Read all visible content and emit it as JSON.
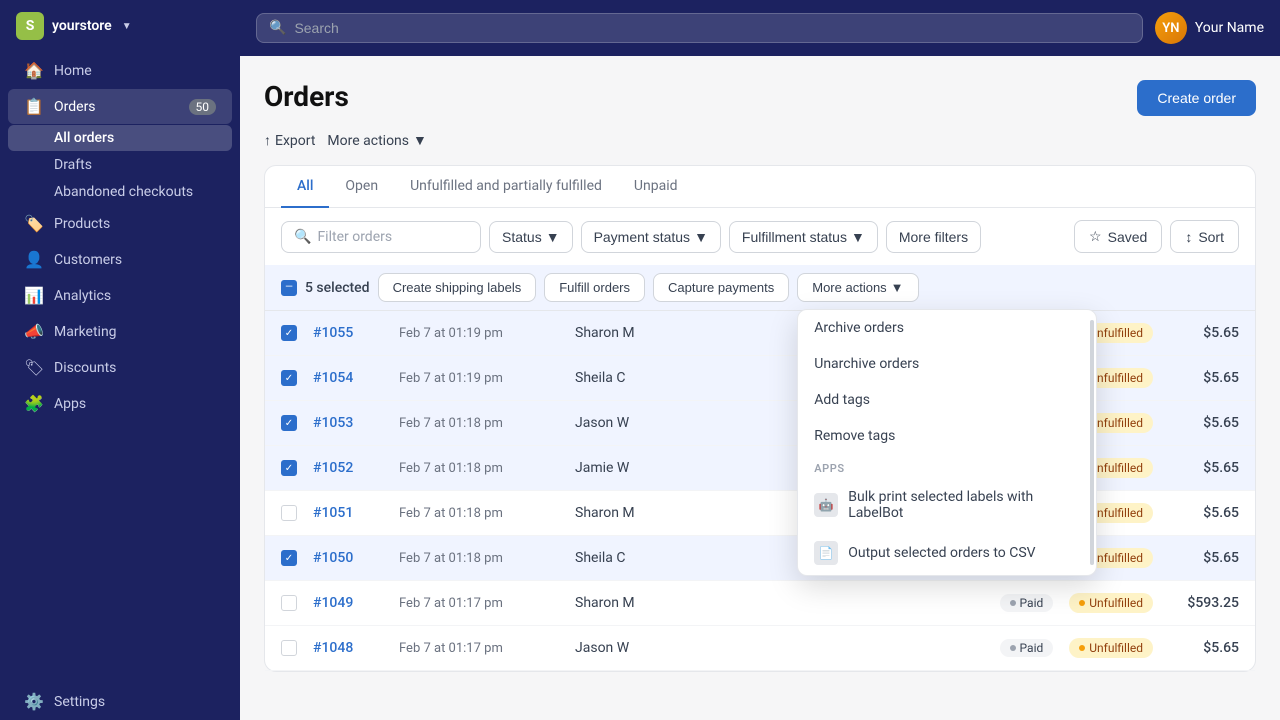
{
  "sidebar": {
    "store": {
      "name": "yourstore",
      "logo": "S"
    },
    "nav_items": [
      {
        "id": "home",
        "label": "Home",
        "icon": "🏠",
        "badge": null
      },
      {
        "id": "orders",
        "label": "Orders",
        "icon": "📋",
        "badge": "50"
      },
      {
        "id": "products",
        "label": "Products",
        "icon": "🏷️",
        "badge": null
      },
      {
        "id": "customers",
        "label": "Customers",
        "icon": "👤",
        "badge": null
      },
      {
        "id": "analytics",
        "label": "Analytics",
        "icon": "📊",
        "badge": null
      },
      {
        "id": "marketing",
        "label": "Marketing",
        "icon": "📣",
        "badge": null
      },
      {
        "id": "discounts",
        "label": "Discounts",
        "icon": "🏷",
        "badge": null
      },
      {
        "id": "apps",
        "label": "Apps",
        "icon": "🧩",
        "badge": null
      }
    ],
    "orders_sub": [
      {
        "id": "all-orders",
        "label": "All orders",
        "active": true
      },
      {
        "id": "drafts",
        "label": "Drafts",
        "active": false
      },
      {
        "id": "abandoned-checkouts",
        "label": "Abandoned checkouts",
        "active": false
      }
    ],
    "settings": {
      "label": "Settings",
      "icon": "⚙️"
    }
  },
  "topbar": {
    "search_placeholder": "Search",
    "user_name": "Your Name",
    "user_initials": "YN"
  },
  "page": {
    "title": "Orders",
    "create_order_label": "Create order",
    "export_label": "Export",
    "more_actions_label": "More actions"
  },
  "tabs": [
    {
      "id": "all",
      "label": "All",
      "active": true
    },
    {
      "id": "open",
      "label": "Open",
      "active": false
    },
    {
      "id": "unfulfilled",
      "label": "Unfulfilled and partially fulfilled",
      "active": false
    },
    {
      "id": "unpaid",
      "label": "Unpaid",
      "active": false
    }
  ],
  "filters": {
    "search_placeholder": "Filter orders",
    "status_label": "Status",
    "payment_status_label": "Payment status",
    "fulfillment_status_label": "Fulfillment status",
    "more_filters_label": "More filters",
    "saved_label": "Saved",
    "sort_label": "Sort"
  },
  "bulk": {
    "selected_count": "5 selected",
    "create_shipping_labels": "Create shipping labels",
    "fulfill_orders": "Fulfill orders",
    "capture_payments": "Capture payments",
    "more_actions": "More actions"
  },
  "orders": [
    {
      "id": "1055",
      "num": "#1055",
      "date": "Feb 7 at 01:19 pm",
      "customer": "Sharon M",
      "payment": null,
      "fulfillment": "Unfulfilled",
      "amount": "$5.65",
      "checked": true
    },
    {
      "id": "1054",
      "num": "#1054",
      "date": "Feb 7 at 01:19 pm",
      "customer": "Sheila C",
      "payment": null,
      "fulfillment": "Unfulfilled",
      "amount": "$5.65",
      "checked": true
    },
    {
      "id": "1053",
      "num": "#1053",
      "date": "Feb 7 at 01:18 pm",
      "customer": "Jason W",
      "payment": null,
      "fulfillment": "Unfulfilled",
      "amount": "$5.65",
      "checked": true
    },
    {
      "id": "1052",
      "num": "#1052",
      "date": "Feb 7 at 01:18 pm",
      "customer": "Jamie W",
      "payment": null,
      "fulfillment": "Unfulfilled",
      "amount": "$5.65",
      "checked": true
    },
    {
      "id": "1051",
      "num": "#1051",
      "date": "Feb 7 at 01:18 pm",
      "customer": "Sharon M",
      "payment": null,
      "fulfillment": "Unfulfilled",
      "amount": "$5.65",
      "checked": false
    },
    {
      "id": "1050",
      "num": "#1050",
      "date": "Feb 7 at 01:18 pm",
      "customer": "Sheila C",
      "payment": null,
      "fulfillment": "Unfulfilled",
      "amount": "$5.65",
      "checked": true
    },
    {
      "id": "1049",
      "num": "#1049",
      "date": "Feb 7 at 01:17 pm",
      "customer": "Sharon M",
      "payment": "Paid",
      "fulfillment": "Unfulfilled",
      "amount": "$593.25",
      "checked": false
    },
    {
      "id": "1048",
      "num": "#1048",
      "date": "Feb 7 at 01:17 pm",
      "customer": "Jason W",
      "payment": "Paid",
      "fulfillment": "Unfulfilled",
      "amount": "$5.65",
      "checked": false
    }
  ],
  "dropdown": {
    "items": [
      {
        "id": "archive",
        "label": "Archive orders",
        "icon": null,
        "section": null
      },
      {
        "id": "unarchive",
        "label": "Unarchive orders",
        "icon": null,
        "section": null
      },
      {
        "id": "add-tags",
        "label": "Add tags",
        "icon": null,
        "section": null
      },
      {
        "id": "remove-tags",
        "label": "Remove tags",
        "icon": null,
        "section": null
      }
    ],
    "section_label": "APPS",
    "app_items": [
      {
        "id": "labelbot",
        "label": "Bulk print selected labels with LabelBot",
        "icon": "🤖"
      },
      {
        "id": "csv",
        "label": "Output selected orders to CSV",
        "icon": "📄"
      }
    ]
  }
}
